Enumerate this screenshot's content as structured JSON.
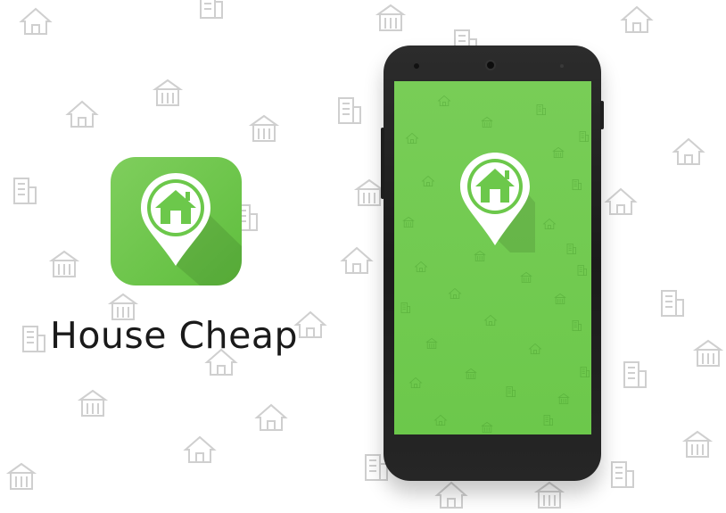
{
  "app": {
    "title": "House Cheap",
    "icon_name": "house-pin-icon"
  },
  "colors": {
    "brand_green": "#6cc84b",
    "brand_green_light": "#7fce5d",
    "phone_body": "#222222",
    "background": "#ffffff",
    "pattern_gray": "#cfcfcf"
  },
  "phone": {
    "screen_icon": "house-pin-icon"
  }
}
